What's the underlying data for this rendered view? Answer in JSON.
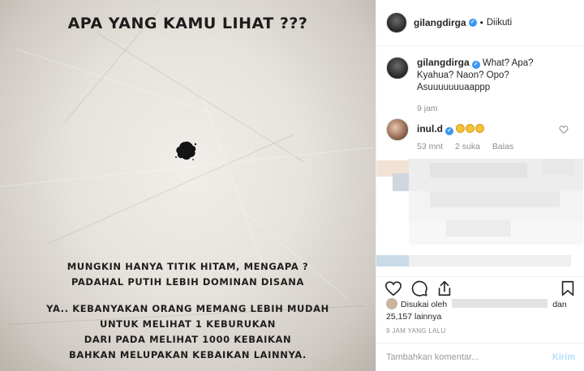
{
  "image": {
    "title": "APA YANG KAMU LIHAT ???",
    "paragraph1": [
      "MUNGKIN HANYA TITIK HITAM, MENGAPA ?",
      "PADAHAL PUTIH LEBIH DOMINAN DISANA"
    ],
    "paragraph2": [
      "YA.. KEBANYAKAN ORANG MEMANG LEBIH MUDAH",
      "UNTUK MELIHAT 1 KEBURUKAN",
      "DARI PADA MELIHAT 1000 KEBAIKAN",
      "BAHKAN MELUPAKAN KEBAIKAN LAINNYA."
    ]
  },
  "header": {
    "username": "gilangdirga",
    "separator": "•",
    "follow_state": "Diikuti"
  },
  "caption": {
    "username": "gilangdirga",
    "text": "What? Apa? Kyahua? Naon? Opo? Asuuuuuuuaappp",
    "time": "9 jam"
  },
  "comment": {
    "username": "inul.d",
    "emoji_count": 3,
    "time": "53 mnt",
    "likes": "2 suka",
    "reply": "Balas"
  },
  "likes": {
    "prefix": "Disukai oleh",
    "suffix": "dan",
    "count": "25,157 lainnya"
  },
  "timestamp": "9 JAM YANG LALU",
  "composer": {
    "placeholder": "Tambahkan komentar...",
    "post_label": "Kirim"
  },
  "colors": {
    "verified": "#3897f0",
    "post_button": "#b2dffc",
    "muted": "#8e8e8e"
  },
  "icons": [
    "heart-icon",
    "comment-icon",
    "share-icon",
    "bookmark-icon"
  ]
}
